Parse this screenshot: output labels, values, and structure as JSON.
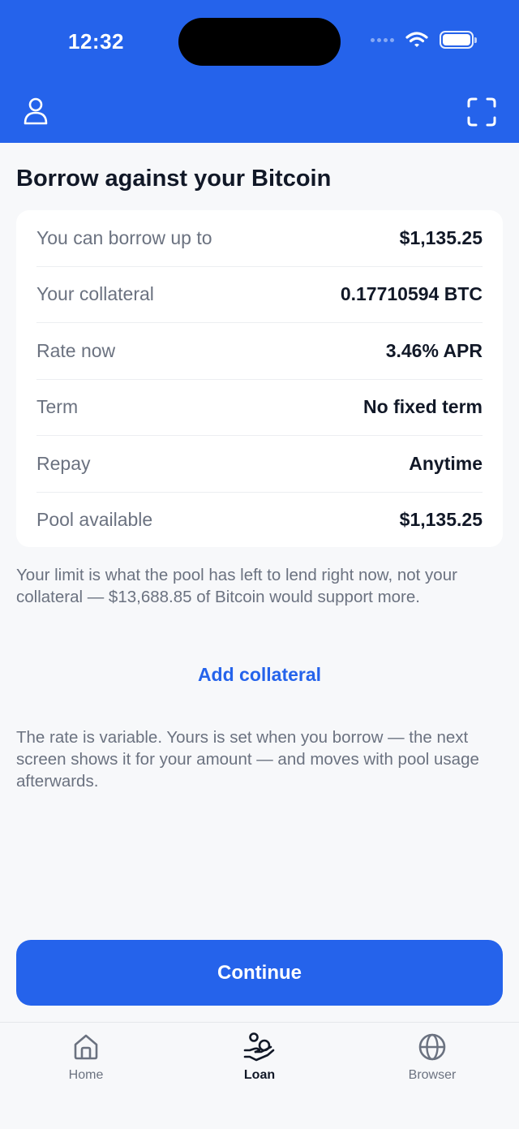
{
  "status_bar": {
    "time": "12:32"
  },
  "header": {
    "profile_icon": "person-icon",
    "scan_icon": "scan-frame-icon",
    "background_color": "#2563eb"
  },
  "main": {
    "title": "Borrow against your Bitcoin",
    "summary": [
      {
        "label": "You can borrow up to",
        "value": "$1,135.25"
      },
      {
        "label": "Your collateral",
        "value": "0.17710594 BTC"
      },
      {
        "label": "Rate now",
        "value": "3.46% APR"
      },
      {
        "label": "Term",
        "value": "No fixed term"
      },
      {
        "label": "Repay",
        "value": "Anytime"
      },
      {
        "label": "Pool available",
        "value": "$1,135.25"
      }
    ],
    "limit_note": "Your limit is what the pool has left to lend right now, not your collateral — $13,688.85 of Bitcoin would support more.",
    "add_collateral_label": "Add collateral",
    "rate_note": "The rate is variable. Yours is set when you borrow — the next screen shows it for your amount — and moves with pool usage afterwards.",
    "continue_label": "Continue"
  },
  "tabbar": {
    "tabs": [
      {
        "label": "Home",
        "icon": "home-icon",
        "active": false
      },
      {
        "label": "Loan",
        "icon": "loan-icon",
        "active": true
      },
      {
        "label": "Browser",
        "icon": "globe-icon",
        "active": false
      }
    ]
  },
  "colors": {
    "accent": "#2563eb",
    "text_primary": "#111827",
    "text_secondary": "#6b7280",
    "background": "#f7f8fa"
  }
}
